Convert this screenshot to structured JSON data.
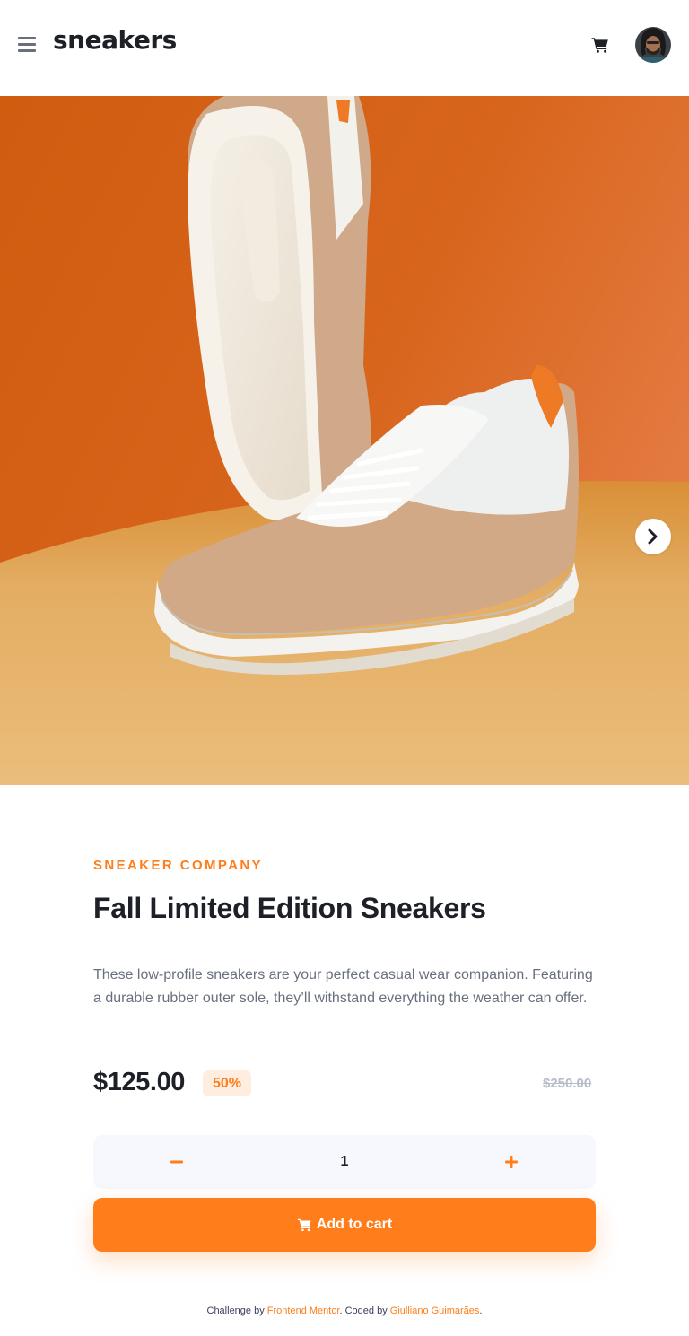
{
  "header": {
    "logo": "sneakers",
    "menu_icon": "hamburger-menu-icon",
    "cart_icon": "cart-icon",
    "avatar_icon": "user-avatar"
  },
  "hero": {
    "next_icon": "chevron-right-icon"
  },
  "product": {
    "company": "SNEAKER COMPANY",
    "title": "Fall Limited Edition Sneakers",
    "description": "These low-profile sneakers are your perfect casual wear companion. Featuring a durable rubber outer sole, they’ll withstand everything the weather can offer.",
    "price": "$125.00",
    "discount": "50%",
    "original_price": "$250.00"
  },
  "quantity": {
    "value": "1",
    "minus_icon": "minus-icon",
    "plus_icon": "plus-icon"
  },
  "cart_button": {
    "label": "Add to cart",
    "icon": "cart-icon"
  },
  "footer": {
    "prefix": "Challenge by ",
    "link1": "Frontend Mentor",
    "middle": ". Coded by ",
    "link2": "Giulliano Guimarães",
    "suffix": "."
  },
  "colors": {
    "accent": "#ff7d1a",
    "accent_light": "#ffede0",
    "text_dark": "#1d2026",
    "text_gray": "#69707d",
    "muted": "#b6bcc8"
  }
}
